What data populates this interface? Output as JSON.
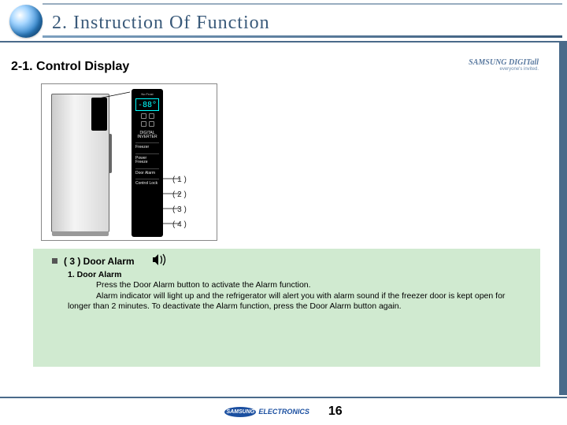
{
  "header": {
    "title": "2. Instruction Of Function"
  },
  "sub_title": "2-1. Control Display",
  "brand": {
    "name": "SAMSUNG DIGITall",
    "tagline": "everyone's invited."
  },
  "panel": {
    "top_label": "No Frost",
    "temp": "-88°",
    "brand_line1": "DIGITAL INVERTER",
    "brand_line2": "",
    "buttons": [
      {
        "label": "Freezer"
      },
      {
        "label": "Power Freeze"
      },
      {
        "label": "Door Alarm"
      },
      {
        "label": "Control Lock"
      }
    ]
  },
  "callouts": [
    "( 1 )",
    "( 2 )",
    "( 3 )",
    "( 4 )"
  ],
  "content": {
    "item_title": "( 3 ) Door Alarm",
    "sub_heading": "1. Door Alarm",
    "line1": "Press the Door Alarm button to activate the Alarm function.",
    "line2": "Alarm indicator will light up and the refrigerator will alert you with alarm sound if the freezer door is kept open for longer than 2 minutes. To deactivate the Alarm function, press the Door Alarm button again."
  },
  "footer": {
    "logo_text": "SAMSUNG",
    "logo_sub": "ELECTRONICS",
    "page": "16"
  }
}
